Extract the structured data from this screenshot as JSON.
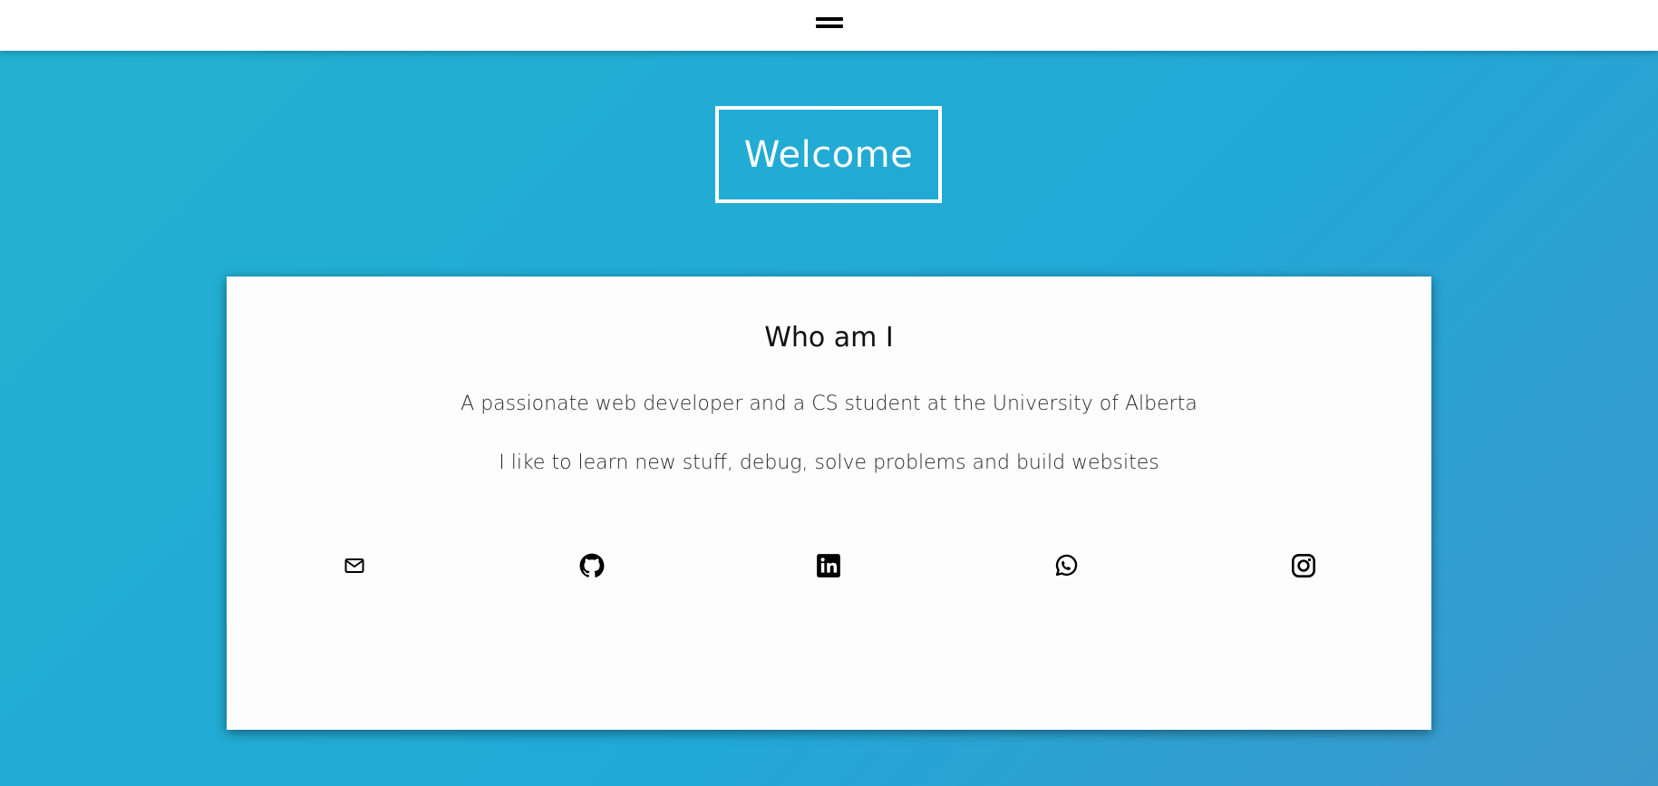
{
  "header": {
    "menu_icon": "hamburger-menu-icon"
  },
  "hero": {
    "title": "Welcome"
  },
  "about": {
    "heading": "Who am I",
    "line_1": "A passionate web developer and a CS student at the University of Alberta",
    "line_2": "I like to learn new stuff, debug, solve problems and build websites"
  },
  "social_links": [
    {
      "name": "email",
      "icon": "mail-icon"
    },
    {
      "name": "github",
      "icon": "github-icon"
    },
    {
      "name": "linkedin",
      "icon": "linkedin-icon"
    },
    {
      "name": "whatsapp",
      "icon": "whatsapp-icon"
    },
    {
      "name": "instagram",
      "icon": "instagram-icon"
    }
  ],
  "colors": {
    "background_gradient_start": "#22b1d1",
    "background_gradient_end": "#3d98cc",
    "card_background": "#fdfdfd",
    "text_primary": "#111111"
  }
}
